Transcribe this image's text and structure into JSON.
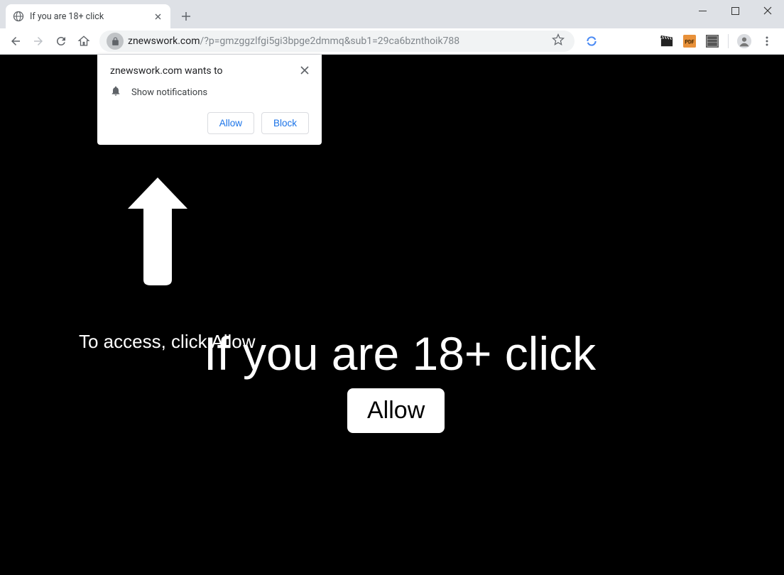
{
  "window": {
    "controls": {
      "minimize": "–",
      "maximize": "□",
      "close": "×"
    }
  },
  "tab": {
    "title": "If you are 18+ click"
  },
  "toolbar": {
    "url_domain": "znewswork.com",
    "url_path": "/?p=gmzggzlfgi5gi3bpge2dmmq&sub1=29ca6bznthoik788"
  },
  "permission": {
    "title": "znewswork.com wants to",
    "row_text": "Show notifications",
    "allow": "Allow",
    "block": "Block"
  },
  "page": {
    "access_text": "To access, click Allow",
    "headline": "If you are 18+ click",
    "allow_button": "Allow"
  }
}
